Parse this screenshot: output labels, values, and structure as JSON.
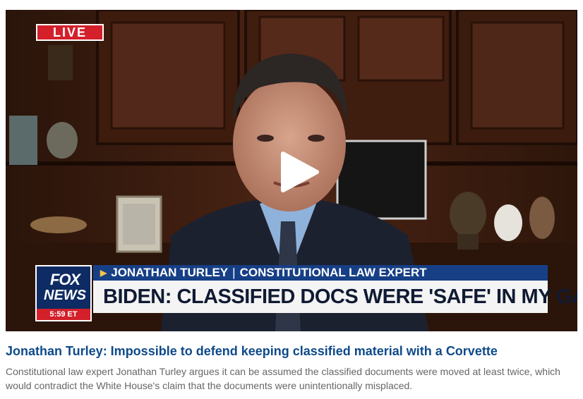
{
  "video": {
    "live_label": "LIVE",
    "lower_third": {
      "logo_top": "FOX",
      "logo_bottom": "NEWS",
      "time": "5:59 ET",
      "guest_name": "JONATHAN TURLEY",
      "guest_title": "CONSTITUTIONAL LAW EXPERT",
      "separator": "|",
      "headline": "BIDEN: CLASSIFIED DOCS WERE 'SAFE' IN MY GARAGE"
    },
    "icons": {
      "play": "play-icon"
    }
  },
  "article": {
    "headline": "Jonathan Turley: Impossible to defend keeping classified material with a Corvette",
    "summary": "Constitutional law expert Jonathan Turley argues it can be assumed the classified documents were moved at least twice, which would contradict the White House's claim that the documents were unintentionally misplaced."
  },
  "colors": {
    "headline_link": "#0e4a8a",
    "summary_text": "#666666",
    "live_red": "#d3202b",
    "fox_blue": "#173f86"
  }
}
